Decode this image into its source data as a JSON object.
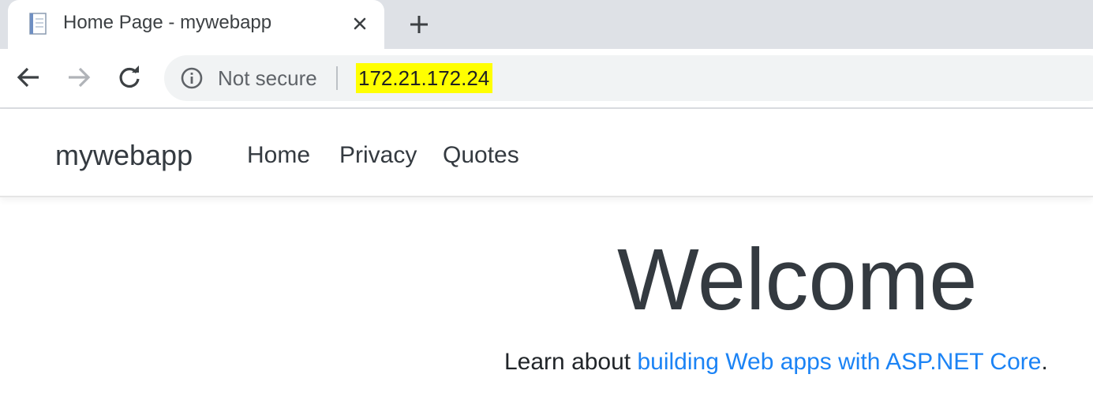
{
  "browser": {
    "tab": {
      "title": "Home Page - mywebapp",
      "favicon": "document-icon",
      "close_icon": "close-icon"
    },
    "new_tab_icon": "plus-icon",
    "toolbar": {
      "back_icon": "arrow-left-icon",
      "forward_icon": "arrow-right-icon",
      "reload_icon": "reload-icon"
    },
    "omnibox": {
      "security_icon": "info-icon",
      "security_text": "Not secure",
      "url": "172.21.172.24",
      "url_highlight_color": "#ffff00"
    }
  },
  "site": {
    "brand": "mywebapp",
    "nav": [
      {
        "label": "Home"
      },
      {
        "label": "Privacy"
      },
      {
        "label": "Quotes"
      }
    ],
    "main": {
      "heading": "Welcome",
      "text_before": "Learn about ",
      "link_text": "building Web apps with ASP.NET Core",
      "text_after": ".",
      "link_color": "#1b83f5"
    }
  }
}
